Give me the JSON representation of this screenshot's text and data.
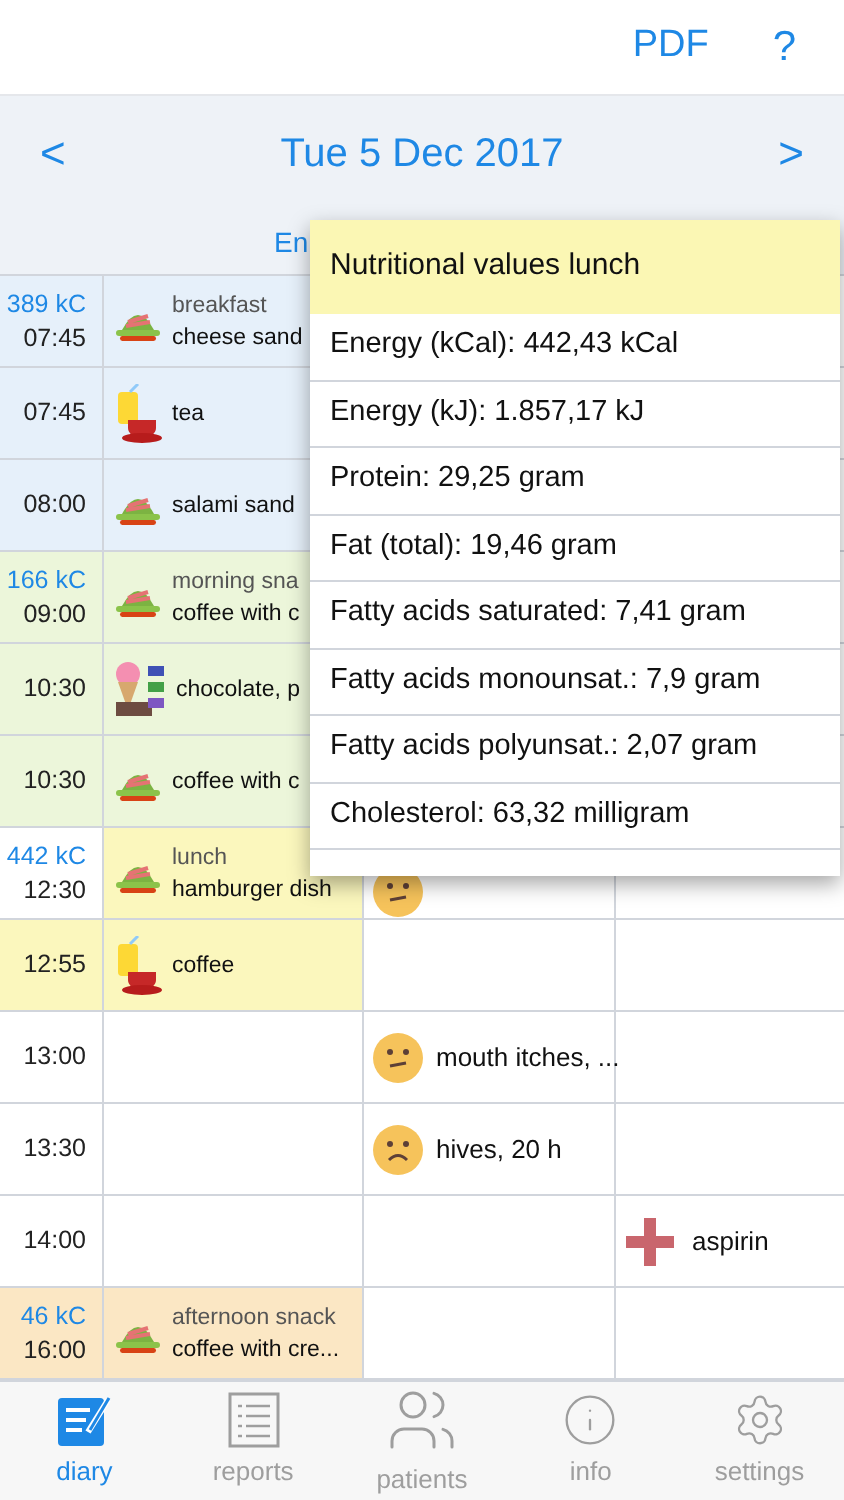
{
  "header": {
    "pdf": "PDF",
    "help": "?"
  },
  "date_nav": {
    "prev": "<",
    "date": "Tue 5 Dec 2017",
    "next": ">",
    "summary": "En"
  },
  "rows": [
    {
      "kcal": "389 kC",
      "time": "07:45",
      "color": "#e6f0fa",
      "food": {
        "kind": "plate",
        "meal": "breakfast",
        "item": "cheese sand"
      }
    },
    {
      "time": "07:45",
      "color": "#e6f0fa",
      "food": {
        "kind": "drink",
        "item": "tea"
      }
    },
    {
      "time": "08:00",
      "color": "#e6f0fa",
      "food": {
        "kind": "plate",
        "item": "salami sand"
      }
    },
    {
      "kcal": "166 kC",
      "time": "09:00",
      "color": "#ecf6da",
      "food": {
        "kind": "plate",
        "meal": "morning sna",
        "item": "coffee with c"
      }
    },
    {
      "time": "10:30",
      "color": "#ecf6da",
      "food": {
        "kind": "sweets",
        "item": "chocolate, p"
      }
    },
    {
      "time": "10:30",
      "color": "#ecf6da",
      "food": {
        "kind": "plate",
        "item": "coffee with c"
      }
    },
    {
      "kcal": "442 kC",
      "time": "12:30",
      "color": "#fbf7bd",
      "time_cell": {
        "color": "#ffffff"
      },
      "food": {
        "kind": "plate",
        "meal": "lunch",
        "item": "hamburger dish"
      },
      "symptom": {
        "kind": "neutral"
      }
    },
    {
      "time": "12:55",
      "color": "#fbf7bd",
      "food": {
        "kind": "drink",
        "item": "coffee"
      }
    },
    {
      "time": "13:00",
      "color": "#ffffff",
      "symptom": {
        "kind": "neutral",
        "text": "mouth itches, ..."
      }
    },
    {
      "time": "13:30",
      "color": "#ffffff",
      "symptom": {
        "kind": "worried",
        "text": "hives, 20 h"
      }
    },
    {
      "time": "14:00",
      "color": "#ffffff",
      "medication": {
        "kind": "cross",
        "text": "aspirin"
      }
    },
    {
      "kcal": "46 kC",
      "time": "16:00",
      "color": "#fbe7c4",
      "food": {
        "kind": "plate",
        "meal": "afternoon snack",
        "item": "coffee with cre..."
      }
    }
  ],
  "popup": {
    "title": "Nutritional values lunch",
    "lines": [
      "Energy (kCal): 442,43 kCal",
      "Energy (kJ): 1.857,17 kJ",
      "Protein: 29,25 gram",
      "Fat (total): 19,46 gram",
      "Fatty acids saturated: 7,41 gram",
      "Fatty acids monounsat.: 7,9 gram",
      "Fatty acids polyunsat.: 2,07 gram",
      "Cholesterol: 63,32 milligram"
    ]
  },
  "tabs": [
    {
      "label": "diary",
      "kind": "diary",
      "selected": true
    },
    {
      "label": "reports",
      "kind": "reports",
      "selected": false
    },
    {
      "label": "patients",
      "kind": "patients",
      "selected": false
    },
    {
      "label": "info",
      "kind": "info",
      "selected": false
    },
    {
      "label": "settings",
      "kind": "settings",
      "selected": false
    }
  ]
}
